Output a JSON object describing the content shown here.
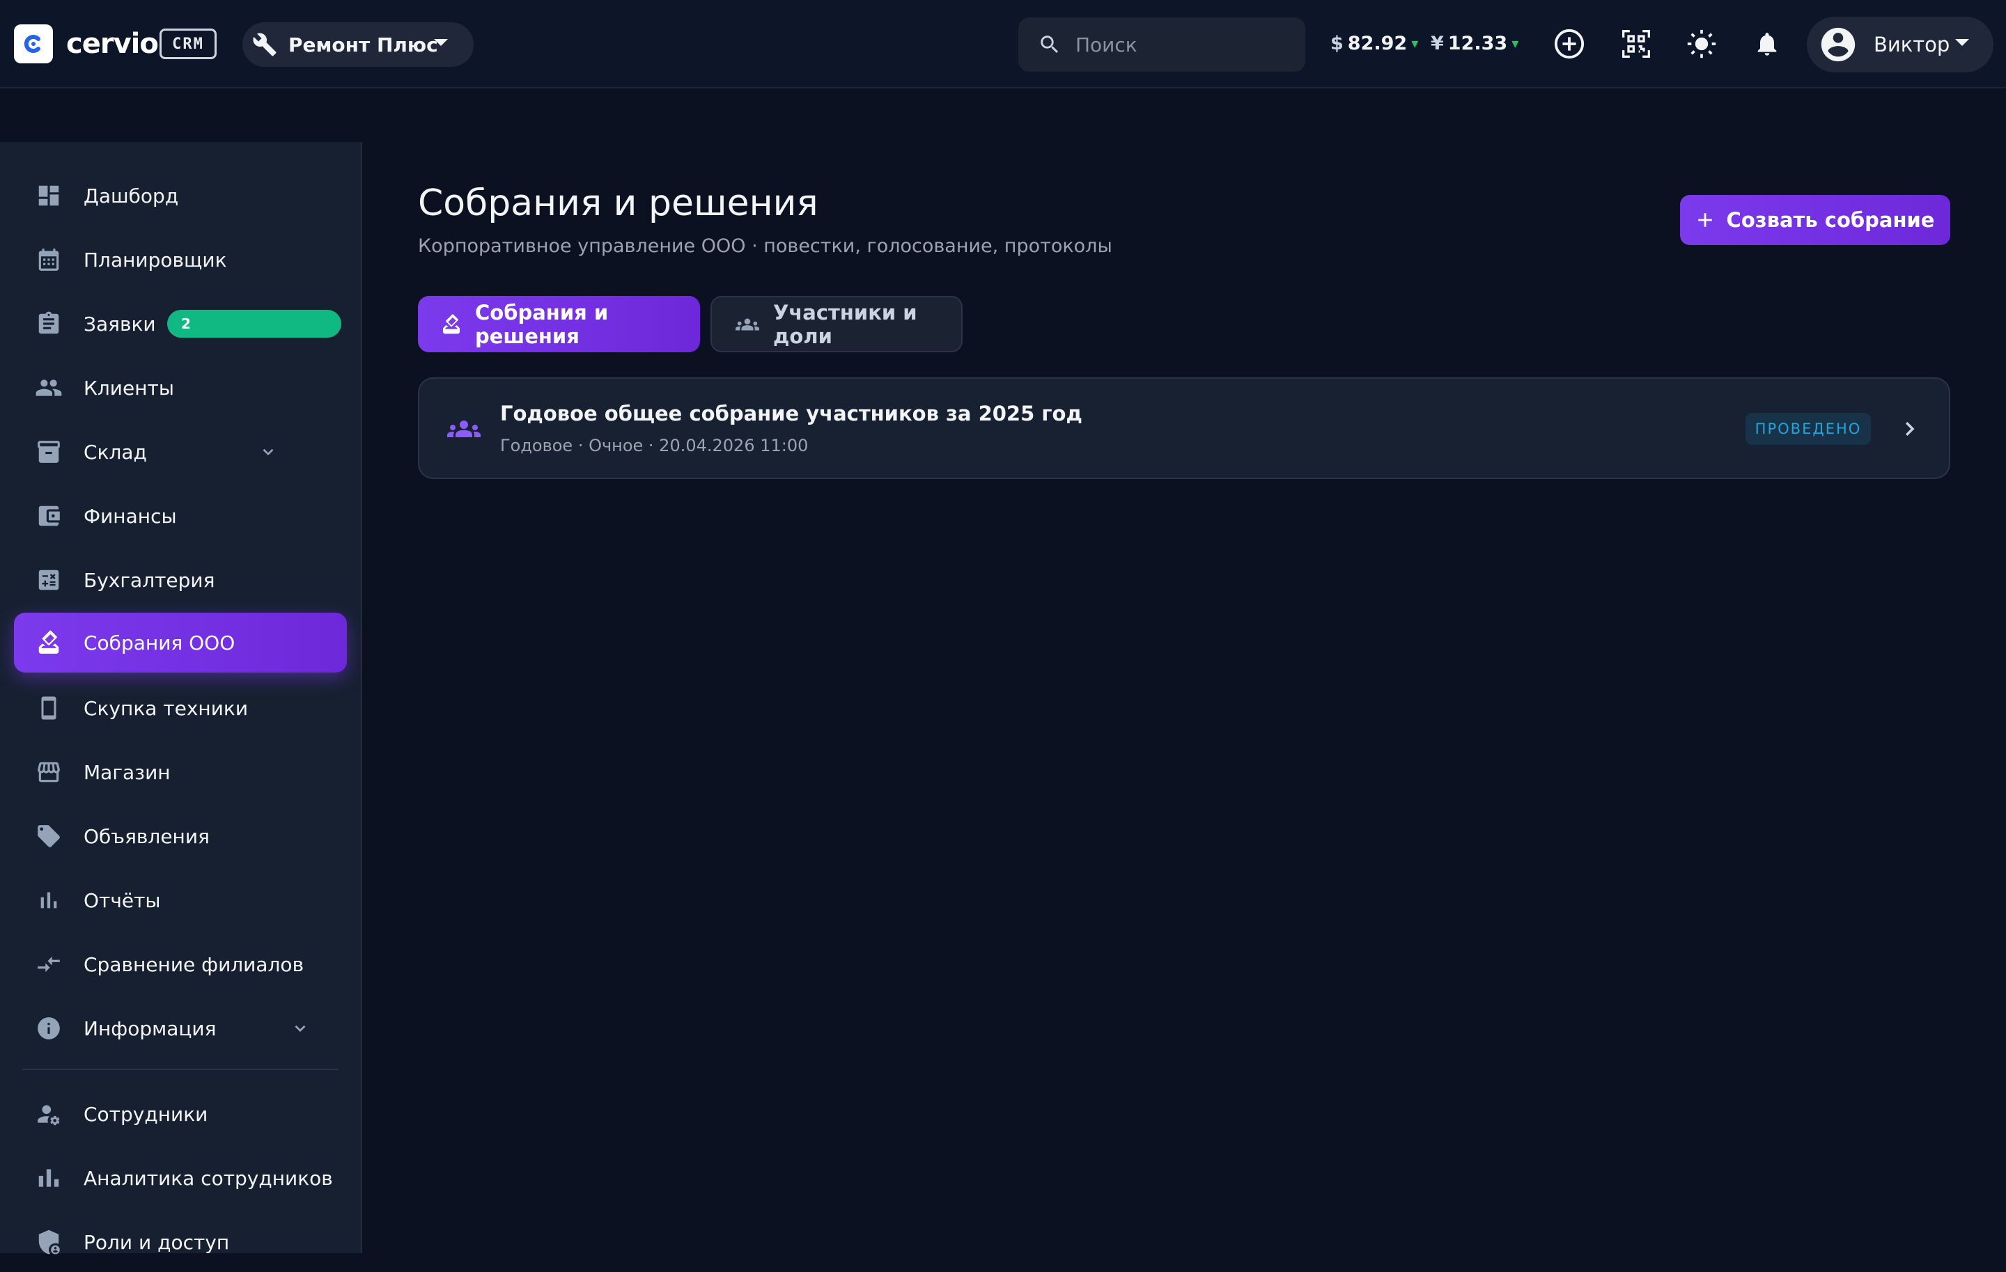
{
  "header": {
    "logo_text": "cervio",
    "crm_badge": "CRM",
    "company": "Ремонт Плюс",
    "search_placeholder": "Поиск",
    "rates": [
      {
        "symbol": "$",
        "value": "82.92",
        "trend": "▾"
      },
      {
        "symbol": "¥",
        "value": "12.33",
        "trend": "▾"
      }
    ],
    "user_name": "Виктор"
  },
  "sidebar": {
    "items": [
      {
        "label": "Дашборд",
        "icon": "dashboard-icon"
      },
      {
        "label": "Планировщик",
        "icon": "calendar-icon"
      },
      {
        "label": "Заявки",
        "icon": "clipboard-icon",
        "badge": "2"
      },
      {
        "label": "Клиенты",
        "icon": "people-icon"
      },
      {
        "label": "Склад",
        "icon": "archive-icon",
        "expandable": true
      },
      {
        "label": "Финансы",
        "icon": "wallet-icon"
      },
      {
        "label": "Бухгалтерия",
        "icon": "calculator-icon"
      },
      {
        "label": "Собрания ООО",
        "icon": "ballot-icon",
        "active": true
      },
      {
        "label": "Скупка техники",
        "icon": "phone-icon"
      },
      {
        "label": "Магазин",
        "icon": "store-icon"
      },
      {
        "label": "Объявления",
        "icon": "tag-icon"
      },
      {
        "label": "Отчёты",
        "icon": "bar-chart-icon"
      },
      {
        "label": "Сравнение филиалов",
        "icon": "compare-arrows-icon"
      },
      {
        "label": "Информация",
        "icon": "info-icon",
        "expandable": true
      },
      {
        "label": "Сотрудники",
        "icon": "user-gear-icon"
      },
      {
        "label": "Аналитика сотрудников",
        "icon": "analytics-icon"
      },
      {
        "label": "Роли и доступ",
        "icon": "shield-lock-icon"
      }
    ]
  },
  "main": {
    "title": "Собрания и решения",
    "subtitle": "Корпоративное управление ООО · повестки, голосование, протоколы",
    "create_button": "Созвать собрание",
    "tabs": [
      {
        "label": "Собрания и решения",
        "active": true
      },
      {
        "label": "Участники и доли",
        "active": false
      }
    ],
    "meetings": [
      {
        "title": "Годовое общее собрание участников за 2025 год",
        "meta": "Годовое · Очное · 20.04.2026 11:00",
        "status": "ПРОВЕДЕНО"
      }
    ]
  },
  "colors": {
    "accent": "#7c3aed",
    "background": "#0b1120",
    "sidebar": "#172031",
    "badge_green": "#10b981",
    "status_blue": "#22a4d8"
  }
}
